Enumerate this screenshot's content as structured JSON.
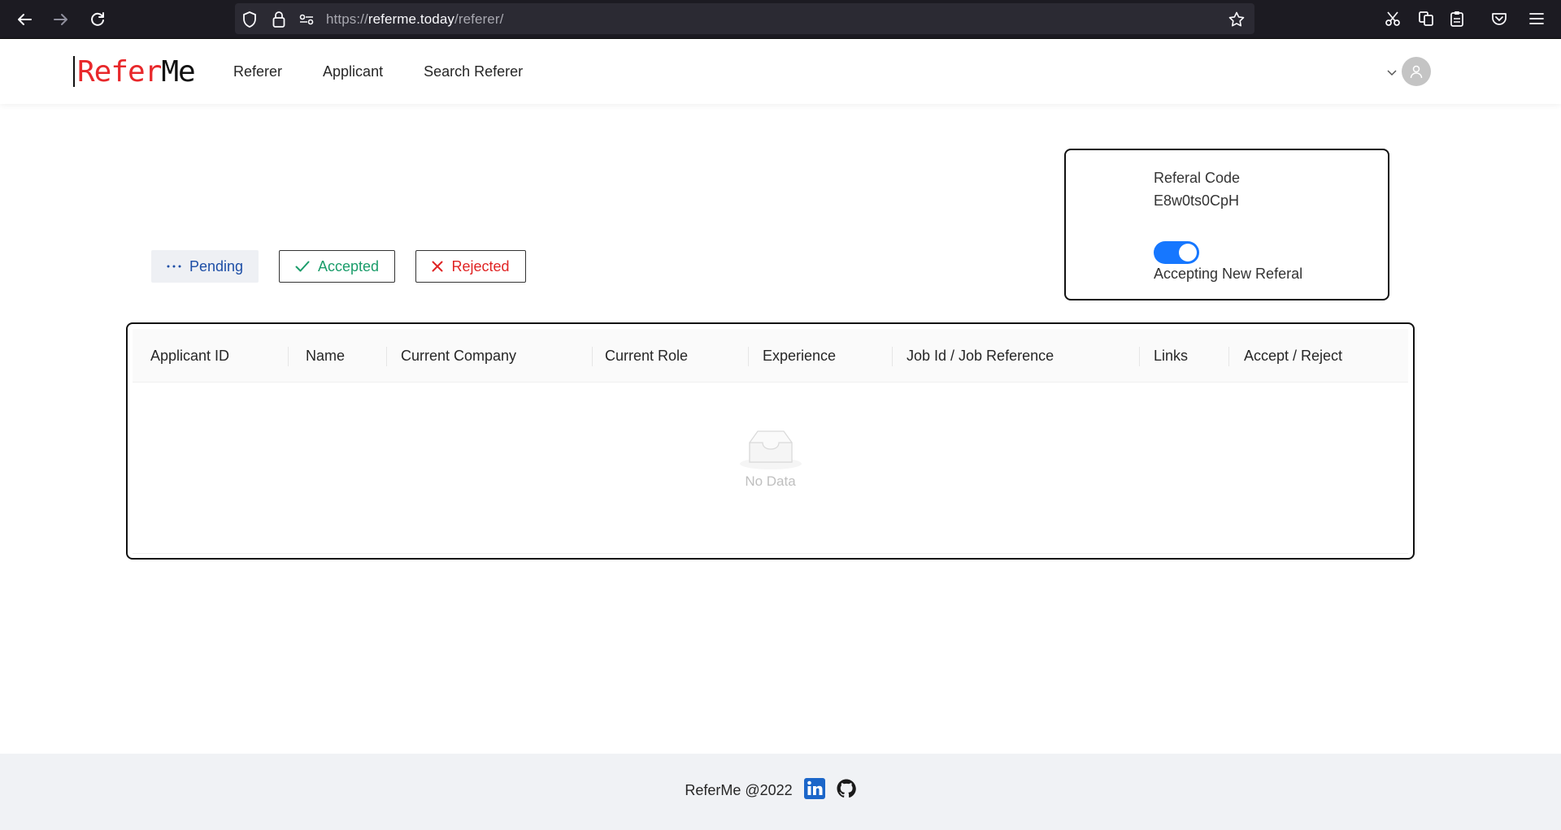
{
  "browser": {
    "url_scheme": "https://",
    "url_domain": "referme.today",
    "url_path": "/referer/"
  },
  "header": {
    "logo_part1": "Refer",
    "logo_part2": "Me",
    "nav": [
      "Referer",
      "Applicant",
      "Search Referer"
    ]
  },
  "referral": {
    "label": "Referal Code",
    "code": "E8w0ts0CpH",
    "toggle_on": true,
    "toggle_label": "Accepting New Referal"
  },
  "filters": {
    "pending": "Pending",
    "accepted": "Accepted",
    "rejected": "Rejected"
  },
  "table": {
    "columns": [
      "Applicant ID",
      "Name",
      "Current Company",
      "Current Role",
      "Experience",
      "Job Id / Job Reference",
      "Links",
      "Accept / Reject"
    ],
    "rows": [],
    "empty_text": "No Data"
  },
  "footer": {
    "text": "ReferMe @2022"
  },
  "colors": {
    "brand_red": "#e8282b",
    "primary_blue": "#1677ff",
    "accepted_green": "#1a9c6a",
    "rejected_red": "#e02424"
  }
}
